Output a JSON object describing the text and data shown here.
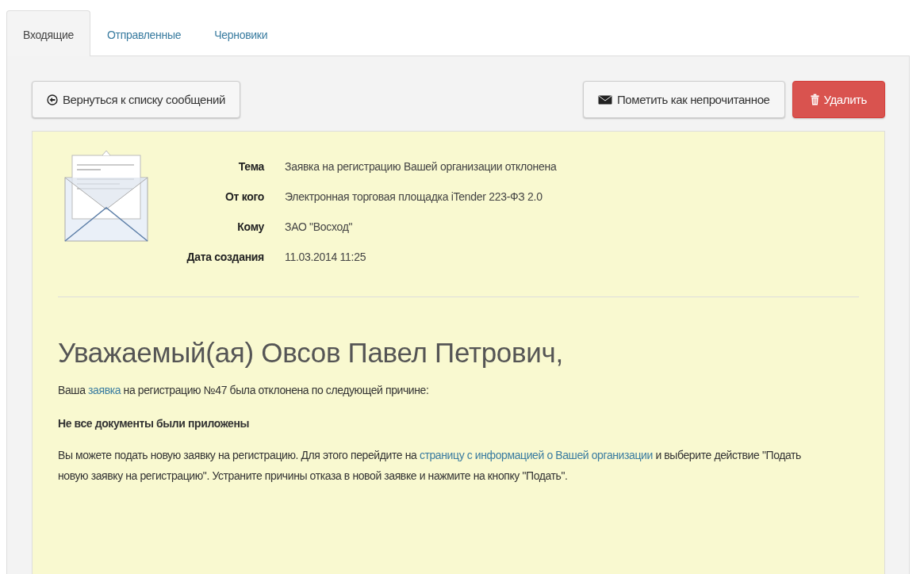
{
  "tabs": [
    {
      "label": "Входящие",
      "selected": true
    },
    {
      "label": "Отправленные",
      "selected": false
    },
    {
      "label": "Черновики",
      "selected": false
    }
  ],
  "toolbar": {
    "back_button": "Вернуться к списку сообщений",
    "mark_unread_button": "Пометить как непрочитанное",
    "delete_button": "Удалить"
  },
  "message": {
    "fields": [
      {
        "label": "Тема",
        "value": "Заявка на регистрацию Вашей организации отклонена"
      },
      {
        "label": "От кого",
        "value": "Электронная торговая площадка iTender 223-ФЗ 2.0"
      },
      {
        "label": "Кому",
        "value": "ЗАО \"Восход\""
      },
      {
        "label": "Дата создания",
        "value": "11.03.2014 11:25"
      }
    ],
    "greeting": "Уважаемый(ая) Овсов Павел Петрович,",
    "paragraphs": [
      {
        "kind": "text",
        "parts": [
          {
            "kind": "text",
            "text": "Ваша "
          },
          {
            "kind": "link",
            "text": "заявка"
          },
          {
            "kind": "text",
            "text": " на регистрацию №47 была отклонена по следующей причине:"
          }
        ]
      },
      {
        "kind": "bold",
        "parts": [
          {
            "kind": "text",
            "text": "Не все документы были приложены"
          }
        ]
      },
      {
        "kind": "text",
        "parts": [
          {
            "kind": "text",
            "text": "Вы можете подать новую заявку на регистрацию. Для этого перейдите на "
          },
          {
            "kind": "link",
            "text": "страницу с информацией о Вашей организации"
          },
          {
            "kind": "text",
            "text": " и выберите действие \"Подать новую заявку на регистрацию\". Устраните причины отказа в новой заявке и нажмите на кнопку \"Подать\"."
          }
        ]
      }
    ]
  }
}
